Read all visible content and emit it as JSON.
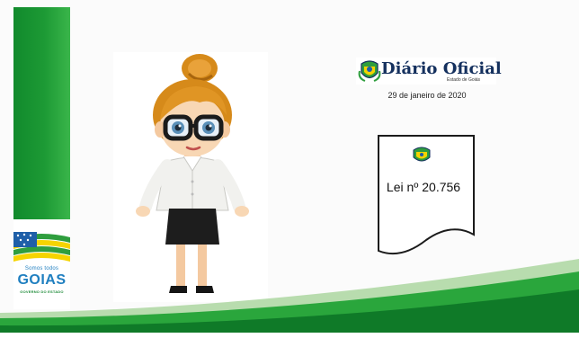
{
  "branding": {
    "tagline": "Somos todos",
    "wordmark": "GOIAS",
    "government_line": "GOVERNO DO ESTADO"
  },
  "diario": {
    "title": "Diário Oficial",
    "subtitle": "Estado de Goiás",
    "date": "29 de janeiro de 2020"
  },
  "document": {
    "law_number": "Lei nº 20.756"
  },
  "colors": {
    "brand_green": "#1d9a35",
    "brand_blue": "#1f7fc0",
    "brand_yellow": "#f5d400",
    "diario_navy": "#14305e"
  },
  "icons": {
    "state_seal": "goias-coat-of-arms-icon",
    "character": "teacher-character-illustration"
  }
}
